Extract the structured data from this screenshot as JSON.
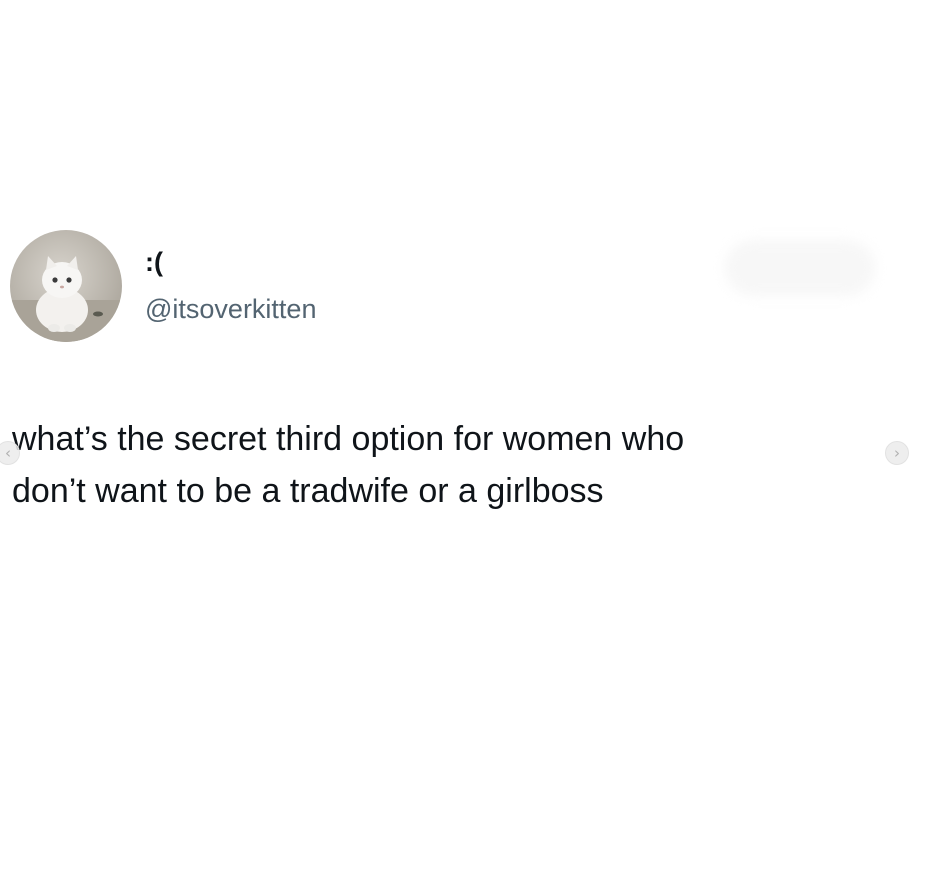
{
  "tweet": {
    "display_name": ":(",
    "handle": "@itsoverkitten",
    "text_line1": "what’s the secret third option for women who",
    "text_line2": "don’t want to be a tradwife or a girlboss"
  },
  "avatar": {
    "icon": "white-kitten-photo"
  },
  "carousel": {
    "prev_icon": "chevron-left-icon",
    "next_icon": "chevron-right-icon",
    "prev_glyph": "‹",
    "next_glyph": "›"
  },
  "colors": {
    "background": "#ffffff",
    "text": "#0f1419",
    "handle": "#536471"
  }
}
